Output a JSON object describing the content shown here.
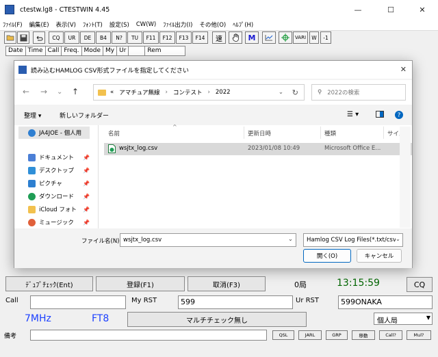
{
  "window": {
    "title": "ctestw.lg8  - CTESTWIN  4.45",
    "minimize": "—",
    "maximize": "☐",
    "close": "✕"
  },
  "menu": [
    "ﾌｧｲﾙ(F)",
    "編集(E)",
    "表示(V)",
    "ﾌｫﾝﾄ(T)",
    "設定(S)",
    "CW(W)",
    "ﾌｧｲﾙ出力(I)",
    "その他(O)",
    "ﾍﾙﾌﾟ(H)"
  ],
  "toolbar": {
    "text_buttons": [
      "CQ",
      "UR",
      "DE",
      "B4",
      "N?",
      "TU",
      "F11",
      "F12",
      "F13",
      "F14"
    ],
    "speed": "速",
    "m": "M",
    "vari": "VARI",
    "w": "W",
    "minus1": "-1"
  },
  "log_columns": [
    "Date",
    "Time",
    "Call",
    "Freq.",
    "Mode",
    "My",
    "Ur",
    "",
    "Rem"
  ],
  "dialog": {
    "title": "読み込むHAMLOG CSV形式ファイルを指定してください",
    "close": "✕",
    "breadcrumb": [
      "«",
      "アマチュア無線",
      "コンテスト",
      "2022"
    ],
    "search_placeholder": "2022の検索",
    "organize": "整理 ▾",
    "new_folder": "新しいフォルダー",
    "nav_items": [
      {
        "label": "JA4JOE - 個人用",
        "icon": "cloud-icon",
        "color": "#2f7fd1"
      },
      {
        "label": "ドキュメント",
        "icon": "documents-icon",
        "color": "#4b7fd6"
      },
      {
        "label": "デスクトップ",
        "icon": "desktop-icon",
        "color": "#2f8fd8"
      },
      {
        "label": "ピクチャ",
        "icon": "pictures-icon",
        "color": "#2d7fd0"
      },
      {
        "label": "ダウンロード",
        "icon": "downloads-icon",
        "color": "#1f9d55"
      },
      {
        "label": "iCloud フォト",
        "icon": "folder-icon",
        "color": "#f2c14e"
      },
      {
        "label": "ミュージック",
        "icon": "music-icon",
        "color": "#e0603a"
      }
    ],
    "columns": {
      "name": "名前",
      "date": "更新日時",
      "type": "種類",
      "size": "サイズ"
    },
    "files": [
      {
        "name": "wsjtx_log.csv",
        "date": "2023/01/08 10:49",
        "type": "Microsoft Office E..."
      }
    ],
    "filename_label": "ファイル名(N):",
    "filename_value": "wsjtx_log.csv",
    "filter_value": "Hamlog CSV Log Files(*.txt/csv)",
    "open_button": "開く(O)",
    "cancel_button": "キャンセル"
  },
  "form": {
    "dupe_check": "ﾃﾞｭﾌﾟﾁｪｯｸ(Ent)",
    "register": "登録(F1)",
    "cancel": "取消(F3)",
    "count": "0局",
    "clock": "13:15:59",
    "cq": "CQ",
    "call_label": "Call",
    "my_rst_label": "My RST",
    "my_rst_value": "599",
    "ur_rst_label": "Ur RST",
    "ur_rst_value": "599ONAKA",
    "band": "7MHz",
    "mode": "FT8",
    "multi_check": "マルチチェック無し",
    "category": "個人局",
    "remarks_label": "備考",
    "small_buttons": [
      "QSL",
      "JARL",
      "GRP",
      "移動",
      "Call?",
      "Mul?"
    ]
  },
  "colors": {
    "clock": "#006400",
    "band_mode": "#1a3fff",
    "accent": "#0067c0"
  }
}
